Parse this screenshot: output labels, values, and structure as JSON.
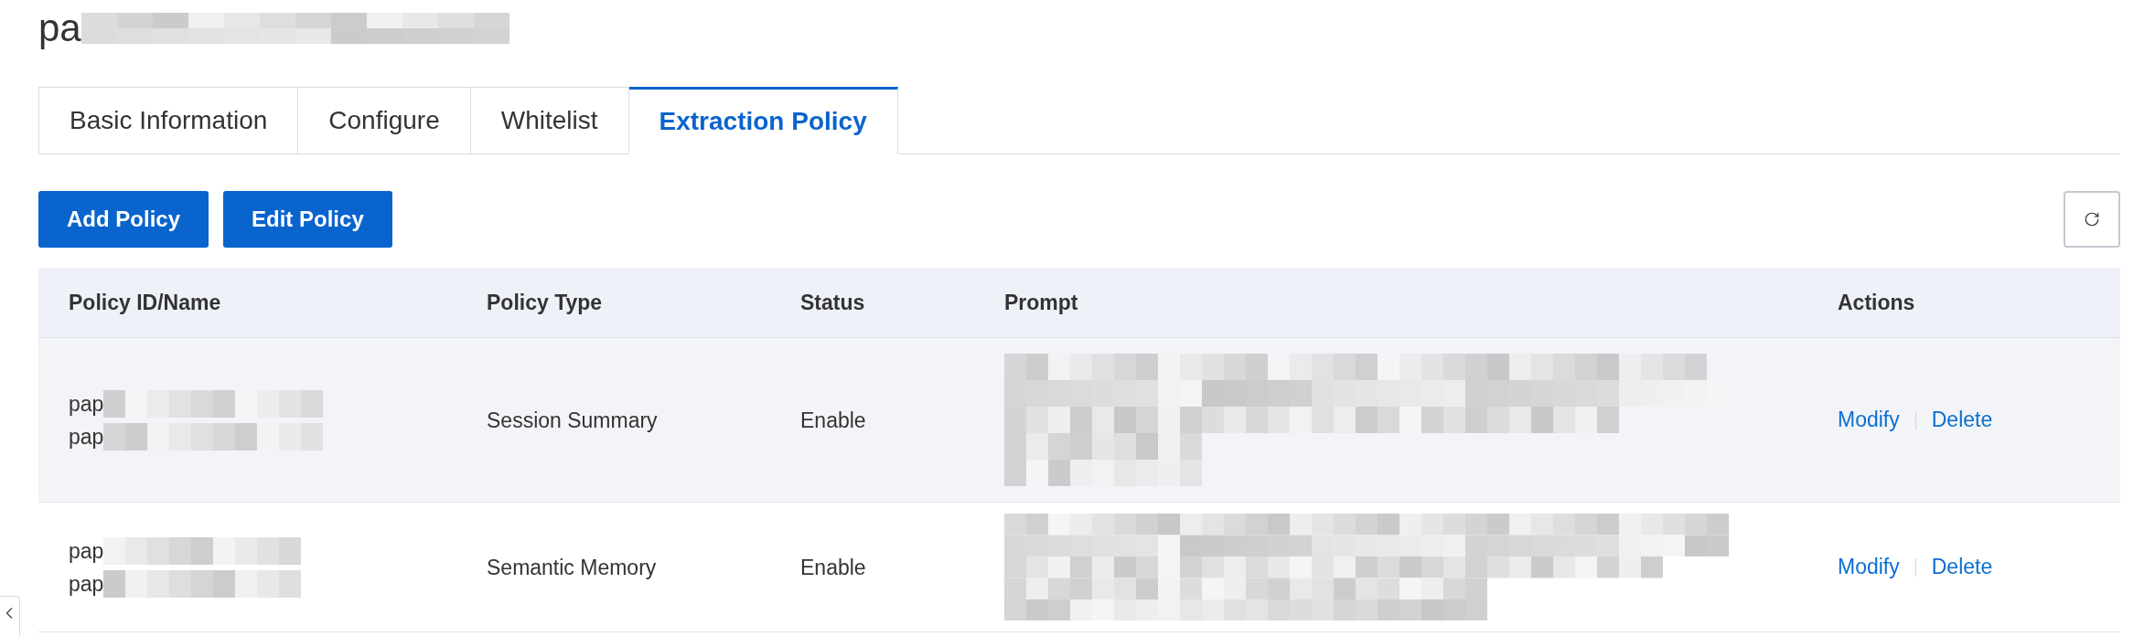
{
  "page_title": {
    "text": "pa",
    "redacted": true
  },
  "tabs": [
    {
      "label": "Basic Information",
      "selected": false
    },
    {
      "label": "Configure",
      "selected": false
    },
    {
      "label": "Whitelist",
      "selected": false
    },
    {
      "label": "Extraction Policy",
      "selected": true
    }
  ],
  "toolbar": {
    "buttons": [
      "Add Policy",
      "Edit Policy"
    ]
  },
  "table": {
    "columns": [
      "Policy ID/Name",
      "Policy Type",
      "Status",
      "Prompt",
      "Actions"
    ],
    "rows": [
      {
        "hovered": true,
        "id_lines": [
          {
            "text": "pap",
            "redacted": true
          },
          {
            "text": "pap",
            "redacted": true
          }
        ],
        "policy_type": "Session Summary",
        "status": "Enable",
        "prompt": {
          "redacted": true
        },
        "actions": [
          "Modify",
          "Delete"
        ]
      },
      {
        "hovered": false,
        "id_lines": [
          {
            "text": "pap",
            "redacted": true
          },
          {
            "text": "pap",
            "redacted": true
          }
        ],
        "policy_type": "Semantic Memory",
        "status": "Enable",
        "prompt": {
          "redacted": true
        },
        "actions": [
          "Modify",
          "Delete"
        ]
      }
    ]
  }
}
